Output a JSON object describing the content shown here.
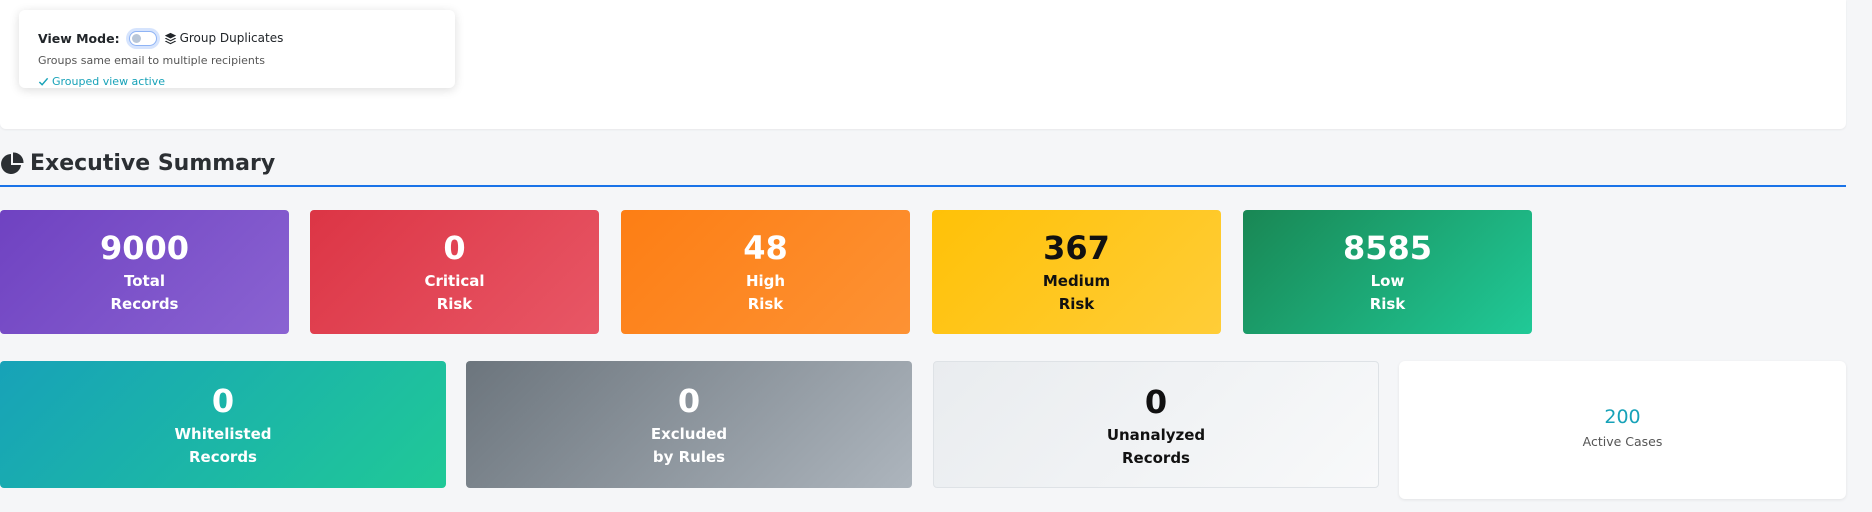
{
  "view_mode": {
    "label": "View Mode:",
    "toggle_on": false,
    "option_label": "Group Duplicates",
    "description": "Groups same email to multiple recipients",
    "status": "Grouped view active"
  },
  "section": {
    "title": "Executive Summary"
  },
  "summary_cards": [
    {
      "value": "9000",
      "label_line1": "Total",
      "label_line2": "Records",
      "color": "#6f42c1"
    },
    {
      "value": "0",
      "label_line1": "Critical",
      "label_line2": "Risk",
      "color": "#dc3545"
    },
    {
      "value": "48",
      "label_line1": "High",
      "label_line2": "Risk",
      "color": "#fd7e14"
    },
    {
      "value": "367",
      "label_line1": "Medium",
      "label_line2": "Risk",
      "color": "#ffc107"
    },
    {
      "value": "8585",
      "label_line1": "Low",
      "label_line2": "Risk",
      "color": "#198754"
    }
  ],
  "secondary_cards": [
    {
      "value": "0",
      "label_line1": "Whitelisted",
      "label_line2": "Records",
      "color": "#17a2b8"
    },
    {
      "value": "0",
      "label_line1": "Excluded",
      "label_line2": "by Rules",
      "color": "#6c757d"
    },
    {
      "value": "0",
      "label_line1": "Unanalyzed",
      "label_line2": "Records",
      "color": "#e9ecef"
    }
  ],
  "active_cases": {
    "value": "200",
    "label": "Active Cases",
    "color": "#17a2b8"
  },
  "icons": {
    "pie": "chart-pie-icon",
    "layers": "layer-group-icon",
    "check": "check-icon"
  },
  "accent_color": "#1a73e8"
}
